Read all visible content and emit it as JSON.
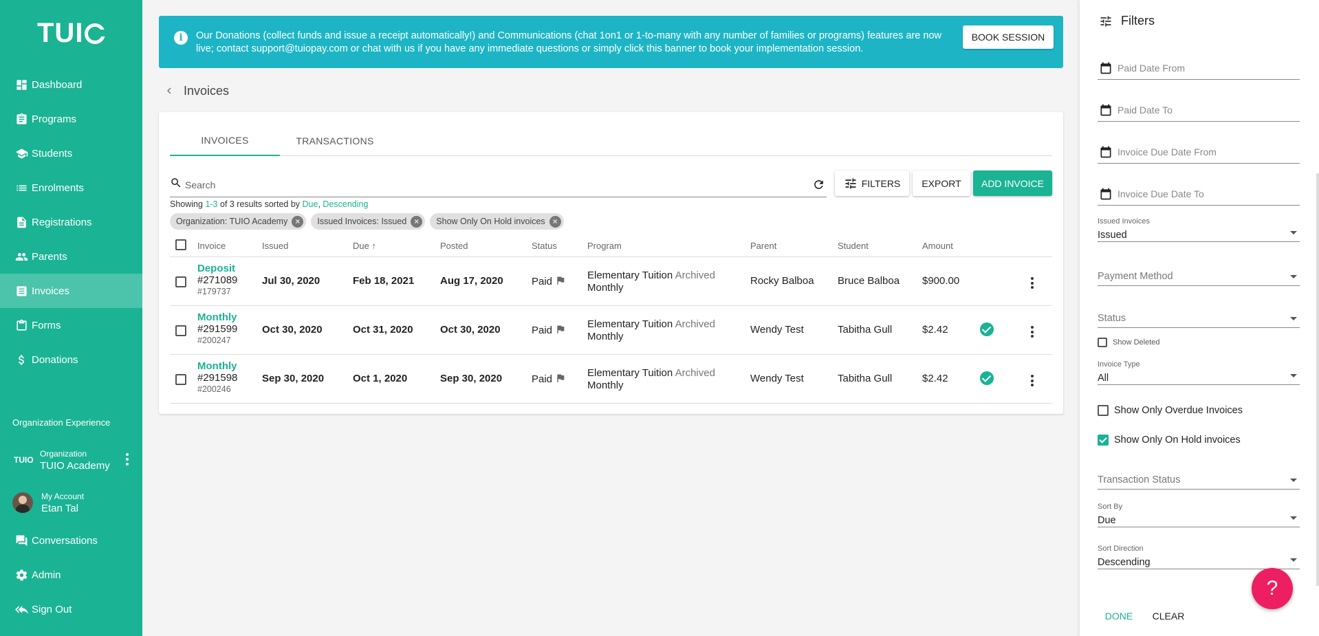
{
  "brand": {
    "logo_text": "TUI",
    "accent": "#1ab394",
    "banner_color": "#1db5c5",
    "fab_color": "#ee1e62"
  },
  "sidebar": {
    "items": [
      {
        "label": "Dashboard",
        "icon": "dashboard-icon"
      },
      {
        "label": "Programs",
        "icon": "clipboard-icon"
      },
      {
        "label": "Students",
        "icon": "school-icon"
      },
      {
        "label": "Enrolments",
        "icon": "list-icon"
      },
      {
        "label": "Registrations",
        "icon": "document-icon"
      },
      {
        "label": "Parents",
        "icon": "people-icon"
      },
      {
        "label": "Invoices",
        "icon": "invoice-icon",
        "active": true
      },
      {
        "label": "Forms",
        "icon": "form-icon"
      },
      {
        "label": "Donations",
        "icon": "dollar-icon"
      }
    ],
    "org_experience": "Organization Experience",
    "org": {
      "mini_logo": "TUIO",
      "caption": "Organization",
      "name": "TUIO Academy"
    },
    "account": {
      "caption": "My Account",
      "name": "Etan Tal"
    },
    "bottom_items": [
      {
        "label": "Conversations",
        "icon": "chat-icon"
      },
      {
        "label": "Admin",
        "icon": "gear-icon"
      },
      {
        "label": "Sign Out",
        "icon": "reply-all-icon"
      }
    ]
  },
  "banner": {
    "text": "Our Donations (collect funds and issue a receipt automatically!) and Communications (chat 1on1 or 1-to-many with any number of families or programs) features are now\nlive; contact support@tuiopay.com or chat with us if you have any immediate questions or simply click this banner to book your implementation session.",
    "button": "BOOK SESSION"
  },
  "page": {
    "title": "Invoices"
  },
  "tabs": [
    {
      "label": "INVOICES",
      "active": true
    },
    {
      "label": "TRANSACTIONS",
      "active": false
    }
  ],
  "toolbar": {
    "search_placeholder": "Search",
    "filters": "FILTERS",
    "export": "EXPORT",
    "add": "ADD INVOICE"
  },
  "showing": {
    "prefix": "Showing ",
    "range": "1-3",
    "middle": " of 3 results sorted by ",
    "sort": "Due",
    "comma": ", ",
    "dir": "Descending"
  },
  "chips": [
    {
      "label": "Organization: TUIO Academy"
    },
    {
      "label": "Issued Invoices: Issued"
    },
    {
      "label": "Show Only On Hold invoices"
    }
  ],
  "table": {
    "headers": {
      "invoice": "Invoice",
      "issued": "Issued",
      "due": "Due",
      "due_arrow": "↑",
      "posted": "Posted",
      "status": "Status",
      "program": "Program",
      "parent": "Parent",
      "student": "Student",
      "amount": "Amount"
    },
    "rows": [
      {
        "type": "Deposit",
        "number": "#271089",
        "sub": "#179737",
        "issued": "Jul 30, 2020",
        "due": "Feb 18, 2021",
        "posted": "Aug 17, 2020",
        "status": "Paid",
        "program": "Elementary Tuition",
        "program_tag": "Archived",
        "program_sub": "Monthly",
        "parent": "Rocky Balboa",
        "student": "Bruce Balboa",
        "amount": "$900.00",
        "verified": false
      },
      {
        "type": "Monthly",
        "number": "#291599",
        "sub": "#200247",
        "issued": "Oct 30, 2020",
        "due": "Oct 31, 2020",
        "posted": "Oct 30, 2020",
        "status": "Paid",
        "program": "Elementary Tuition",
        "program_tag": "Archived",
        "program_sub": "Monthly",
        "parent": "Wendy Test",
        "student": "Tabitha Gull",
        "amount": "$2.42",
        "verified": true
      },
      {
        "type": "Monthly",
        "number": "#291598",
        "sub": "#200246",
        "issued": "Sep 30, 2020",
        "due": "Oct 1, 2020",
        "posted": "Sep 30, 2020",
        "status": "Paid",
        "program": "Elementary Tuition",
        "program_tag": "Archived",
        "program_sub": "Monthly",
        "parent": "Wendy Test",
        "student": "Tabitha Gull",
        "amount": "$2.42",
        "verified": true
      }
    ]
  },
  "filters": {
    "title": "Filters",
    "paid_from": "Paid Date From",
    "paid_to": "Paid Date To",
    "due_from": "Invoice Due Date From",
    "due_to": "Invoice Due Date To",
    "issued_label": "Issued Invoices",
    "issued_value": "Issued",
    "payment_method": "Payment Method",
    "status": "Status",
    "show_deleted": "Show Deleted",
    "invoice_type_label": "Invoice Type",
    "invoice_type_value": "All",
    "overdue": "Show Only Overdue Invoices",
    "on_hold": "Show Only On Hold invoices",
    "transaction_status": "Transaction Status",
    "sort_by_label": "Sort By",
    "sort_by_value": "Due",
    "sort_dir_label": "Sort Direction",
    "sort_dir_value": "Descending",
    "done": "DONE",
    "clear": "CLEAR"
  },
  "help": {
    "label": "?"
  }
}
